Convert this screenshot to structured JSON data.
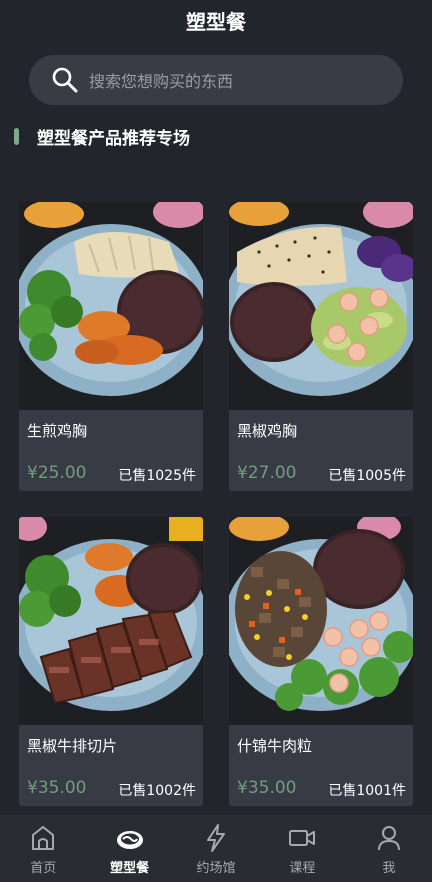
{
  "header": {
    "title": "塑型餐"
  },
  "search": {
    "placeholder": "搜索您想购买的东西"
  },
  "section": {
    "title": "塑型餐产品推荐专场"
  },
  "products": [
    {
      "name": "生煎鸡胸",
      "price": "¥25.00",
      "sold": "已售1025件"
    },
    {
      "name": "黑椒鸡胸",
      "price": "¥27.00",
      "sold": "已售1005件"
    },
    {
      "name": "黑椒牛排切片",
      "price": "¥35.00",
      "sold": "已售1002件"
    },
    {
      "name": "什锦牛肉粒",
      "price": "¥35.00",
      "sold": "已售1001件"
    }
  ],
  "tabbar": {
    "items": [
      {
        "label": "首页",
        "icon": "home-icon",
        "active": false
      },
      {
        "label": "塑型餐",
        "icon": "meal-icon",
        "active": true
      },
      {
        "label": "约场馆",
        "icon": "lightning-icon",
        "active": false
      },
      {
        "label": "课程",
        "icon": "video-icon",
        "active": false
      },
      {
        "label": "我",
        "icon": "person-icon",
        "active": false
      }
    ]
  },
  "colors": {
    "background": "#23252d",
    "card": "#383b46",
    "accent_green": "#6f9f7a",
    "search_bg": "#3a3c45"
  }
}
